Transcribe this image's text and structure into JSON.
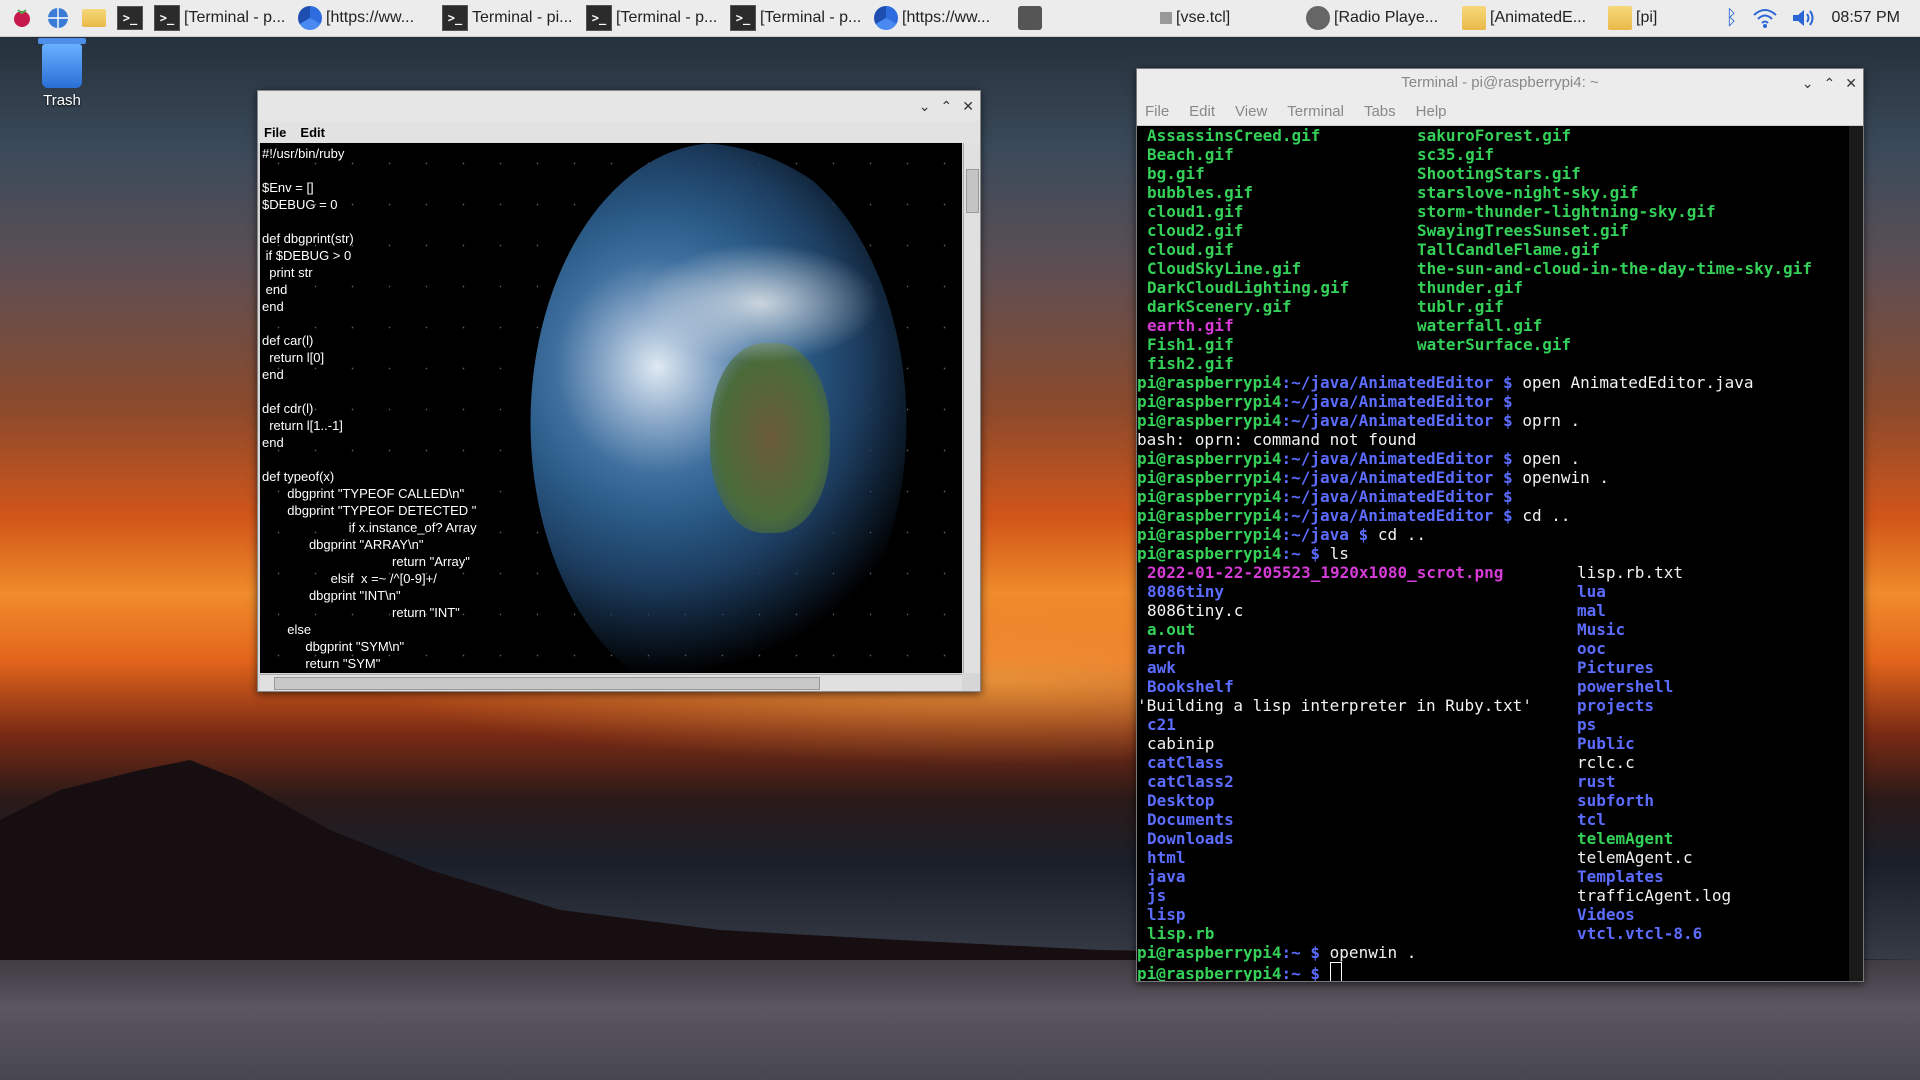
{
  "taskbar": {
    "buttons": [
      {
        "label": "[Terminal - p..."
      },
      {
        "label": "[https://ww..."
      },
      {
        "label": "Terminal - pi..."
      },
      {
        "label": "[Terminal - p..."
      },
      {
        "label": "[Terminal - p..."
      },
      {
        "label": "[https://ww..."
      },
      {
        "label": "[vse.tcl]"
      },
      {
        "label": "[Radio Playe..."
      },
      {
        "label": "[AnimatedE..."
      },
      {
        "label": "[pi]"
      }
    ],
    "clock": "08:57 PM"
  },
  "desktop": {
    "trash_label": "Trash"
  },
  "editor": {
    "menu": {
      "file": "File",
      "edit": "Edit"
    },
    "code": "#!/usr/bin/ruby\n\n$Env = []\n$DEBUG = 0\n\ndef dbgprint(str)\n if $DEBUG > 0\n  print str\n end\nend\n\ndef car(l)\n  return l[0]\nend\n\ndef cdr(l)\n  return l[1..-1]\nend\n\ndef typeof(x)\n       dbgprint \"TYPEOF CALLED\\n\"\n       dbgprint \"TYPEOF DETECTED \"\n                        if x.instance_of? Array\n             dbgprint \"ARRAY\\n\"\n                                    return \"Array\"\n                   elsif  x =~ /^[0-9]+/\n             dbgprint \"INT\\n\"\n                                    return \"INT\"\n       else\n            dbgprint \"SYM\\n\"\n            return \"SYM\""
  },
  "terminal": {
    "title": "Terminal - pi@raspberrypi4: ~",
    "menu": [
      "File",
      "Edit",
      "View",
      "Terminal",
      "Tabs",
      "Help"
    ],
    "gif_left": [
      "AssassinsCreed.gif",
      "Beach.gif",
      "bg.gif",
      "bubbles.gif",
      "cloud1.gif",
      "cloud2.gif",
      "cloud.gif",
      "CloudSkyLine.gif",
      "DarkCloudLighting.gif",
      "darkScenery.gif",
      "earth.gif",
      "Fish1.gif",
      "fish2.gif"
    ],
    "gif_right": [
      "sakuroForest.gif",
      "sc35.gif",
      "ShootingStars.gif",
      "starslove-night-sky.gif",
      "storm-thunder-lightning-sky.gif",
      "SwayingTreesSunset.gif",
      "TallCandleFlame.gif",
      "the-sun-and-cloud-in-the-day-time-sky.gif",
      "thunder.gif",
      "tublr.gif",
      "waterfall.gif",
      "waterSurface.gif"
    ],
    "cmds": [
      {
        "prompt": "pi@raspberrypi4",
        "path": ":~/java/AnimatedEditor $",
        "cmd": " open AnimatedEditor.java"
      },
      {
        "prompt": "pi@raspberrypi4",
        "path": ":~/java/AnimatedEditor $",
        "cmd": ""
      },
      {
        "prompt": "pi@raspberrypi4",
        "path": ":~/java/AnimatedEditor $",
        "cmd": " oprn ."
      },
      {
        "plain": "bash: oprn: command not found"
      },
      {
        "prompt": "pi@raspberrypi4",
        "path": ":~/java/AnimatedEditor $",
        "cmd": " open ."
      },
      {
        "prompt": "pi@raspberrypi4",
        "path": ":~/java/AnimatedEditor $",
        "cmd": " openwin ."
      },
      {
        "prompt": "pi@raspberrypi4",
        "path": ":~/java/AnimatedEditor $",
        "cmd": ""
      },
      {
        "prompt": "pi@raspberrypi4",
        "path": ":~/java/AnimatedEditor $",
        "cmd": " cd .."
      },
      {
        "prompt": "pi@raspberrypi4",
        "path": ":~/java $",
        "cmd": " cd .."
      },
      {
        "prompt": "pi@raspberrypi4",
        "path": ":~ $",
        "cmd": " ls"
      }
    ],
    "ls_left": [
      {
        "t": "2022-01-22-205523_1920x1080_scrot.png",
        "c": "magenta"
      },
      {
        "t": "8086tiny",
        "c": "blue"
      },
      {
        "t": "8086tiny.c",
        "c": "white"
      },
      {
        "t": "a.out",
        "c": "green"
      },
      {
        "t": "arch",
        "c": "blue"
      },
      {
        "t": "awk",
        "c": "blue"
      },
      {
        "t": "Bookshelf",
        "c": "blue"
      },
      {
        "t": "'Building a lisp interpreter in Ruby.txt'",
        "c": "white"
      },
      {
        "t": "c21",
        "c": "blue"
      },
      {
        "t": "cabinip",
        "c": "white"
      },
      {
        "t": "catClass",
        "c": "blue"
      },
      {
        "t": "catClass2",
        "c": "blue"
      },
      {
        "t": "Desktop",
        "c": "blue"
      },
      {
        "t": "Documents",
        "c": "blue"
      },
      {
        "t": "Downloads",
        "c": "blue"
      },
      {
        "t": "html",
        "c": "blue"
      },
      {
        "t": "java",
        "c": "blue"
      },
      {
        "t": "js",
        "c": "blue"
      },
      {
        "t": "lisp",
        "c": "blue"
      },
      {
        "t": "lisp.rb",
        "c": "green"
      }
    ],
    "ls_right": [
      {
        "t": "lisp.rb.txt",
        "c": "white"
      },
      {
        "t": "lua",
        "c": "blue"
      },
      {
        "t": "mal",
        "c": "blue"
      },
      {
        "t": "Music",
        "c": "blue"
      },
      {
        "t": "ooc",
        "c": "blue"
      },
      {
        "t": "Pictures",
        "c": "blue"
      },
      {
        "t": "powershell",
        "c": "blue"
      },
      {
        "t": "projects",
        "c": "blue"
      },
      {
        "t": "ps",
        "c": "blue"
      },
      {
        "t": "Public",
        "c": "blue"
      },
      {
        "t": "rclc.c",
        "c": "white"
      },
      {
        "t": "rust",
        "c": "blue"
      },
      {
        "t": "subforth",
        "c": "blue"
      },
      {
        "t": "tcl",
        "c": "blue"
      },
      {
        "t": "telemAgent",
        "c": "green"
      },
      {
        "t": "telemAgent.c",
        "c": "white"
      },
      {
        "t": "Templates",
        "c": "blue"
      },
      {
        "t": "trafficAgent.log",
        "c": "white"
      },
      {
        "t": "Videos",
        "c": "blue"
      },
      {
        "t": "vtcl.vtcl-8.6",
        "c": "blue"
      }
    ],
    "final": [
      {
        "prompt": "pi@raspberrypi4",
        "path": ":~ $",
        "cmd": " openwin ."
      },
      {
        "prompt": "pi@raspberrypi4",
        "path": ":~ $",
        "cmd": " "
      }
    ]
  }
}
